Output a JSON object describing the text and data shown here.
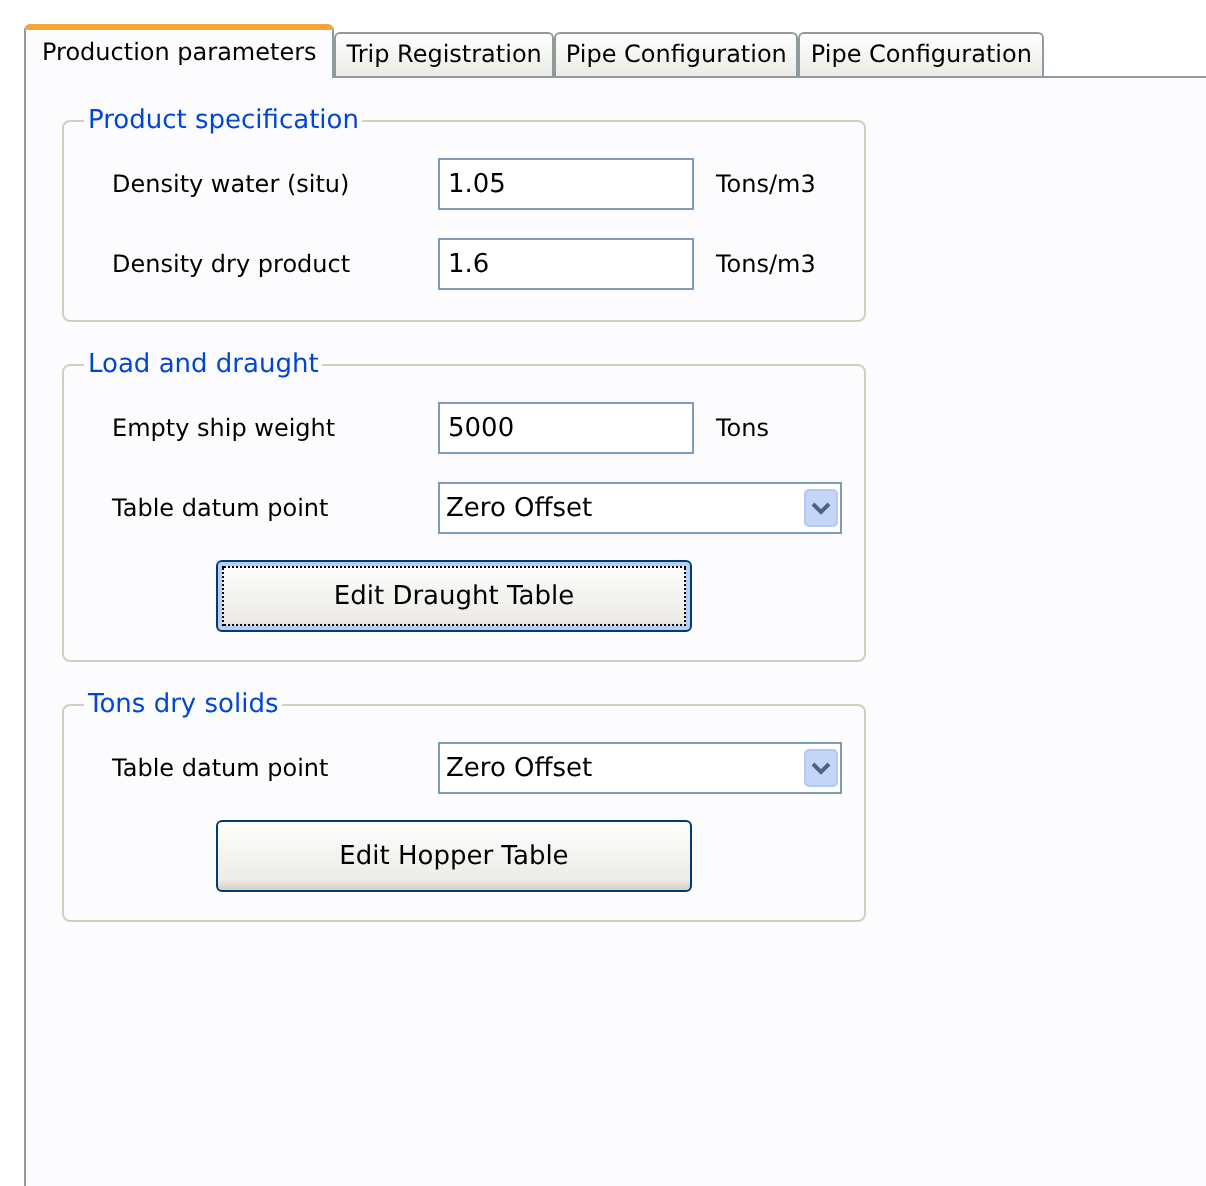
{
  "tabs": [
    {
      "label": "Production parameters",
      "selected": true
    },
    {
      "label": "Trip Registration",
      "selected": false
    },
    {
      "label": "Pipe Configuration",
      "selected": false
    },
    {
      "label": "Pipe Configuration",
      "selected": false
    }
  ],
  "groups": [
    {
      "title": "Product specification",
      "rows": [
        {
          "kind": "text",
          "label": "Density water (situ)",
          "value": "1.05",
          "unit": "Tons/m3"
        },
        {
          "kind": "text",
          "label": "Density dry product",
          "value": "1.6",
          "unit": "Tons/m3"
        }
      ]
    },
    {
      "title": "Load and draught",
      "rows": [
        {
          "kind": "text",
          "label": "Empty ship weight",
          "value": "5000",
          "unit": "Tons"
        },
        {
          "kind": "combo",
          "label": "Table datum point",
          "value": "Zero Offset"
        },
        {
          "kind": "button",
          "label": "Edit Draught Table",
          "focused": true
        }
      ]
    },
    {
      "title": "Tons dry solids",
      "rows": [
        {
          "kind": "combo",
          "label": "Table datum point",
          "value": "Zero Offset"
        },
        {
          "kind": "button",
          "label": "Edit Hopper Table",
          "focused": false
        }
      ]
    }
  ]
}
